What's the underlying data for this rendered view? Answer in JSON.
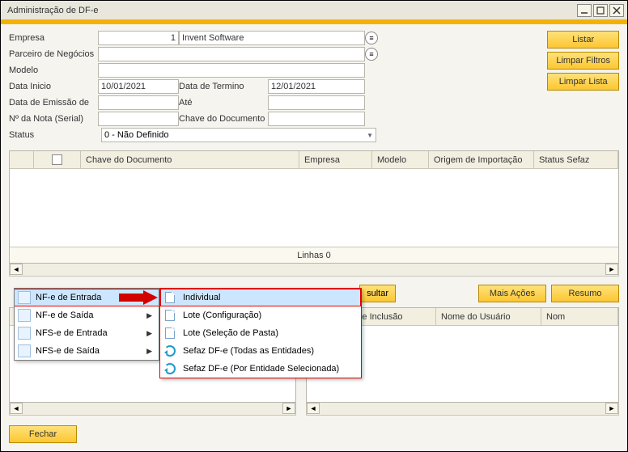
{
  "window": {
    "title": "Administração de DF-e"
  },
  "form": {
    "empresa_label": "Empresa",
    "empresa_id": "1",
    "empresa_name": "Invent Software",
    "parceiro_label": "Parceiro de Negócios",
    "parceiro_value": "",
    "modelo_label": "Modelo",
    "modelo_value": "",
    "data_inicio_label": "Data Inicio",
    "data_inicio_value": "10/01/2021",
    "data_termino_label": "Data de Termino",
    "data_termino_value": "12/01/2021",
    "data_emissao_label": "Data de Emissão de",
    "data_emissao_value": "",
    "ate_label": "Até",
    "ate_value": "",
    "nota_label": "Nº da Nota (Serial)",
    "nota_value": "",
    "chave_label": "Chave do Documento",
    "chave_value": "",
    "status_label": "Status",
    "status_value": "0          - Não Definido"
  },
  "buttons": {
    "listar": "Listar",
    "limpar_filtros": "Limpar Filtros",
    "limpar_lista": "Limpar Lista",
    "consultar_partial": "sultar",
    "mais_acoes": "Mais Ações",
    "resumo": "Resumo",
    "fechar": "Fechar"
  },
  "grid1": {
    "cols": {
      "chave": "Chave do Documento",
      "empresa": "Empresa",
      "modelo": "Modelo",
      "origem": "Origem de Importação",
      "status_sefaz": "Status Sefaz"
    },
    "footer": "Linhas 0"
  },
  "grid2_right": {
    "cols": {
      "data_inclusao": "Data de Inclusão",
      "nome_usuario": "Nome do Usuário",
      "nome_partial": "Nom"
    }
  },
  "menu1": {
    "items": [
      {
        "label": "NF-e de Entrada",
        "highlight": true
      },
      {
        "label": "NF-e de Saída",
        "highlight": false
      },
      {
        "label": "NFS-e de Entrada",
        "highlight": false
      },
      {
        "label": "NFS-e de Saída",
        "highlight": false
      }
    ]
  },
  "menu2": {
    "items": [
      {
        "label": "Individual",
        "icon": "file",
        "highlight": true
      },
      {
        "label": "Lote (Configuração)",
        "icon": "file",
        "highlight": false
      },
      {
        "label": "Lote (Seleção de Pasta)",
        "icon": "file",
        "highlight": false
      },
      {
        "label": "Sefaz DF-e (Todas as Entidades)",
        "icon": "refresh",
        "highlight": false
      },
      {
        "label": "Sefaz DF-e (Por Entidade Selecionada)",
        "icon": "refresh",
        "highlight": false
      }
    ]
  }
}
